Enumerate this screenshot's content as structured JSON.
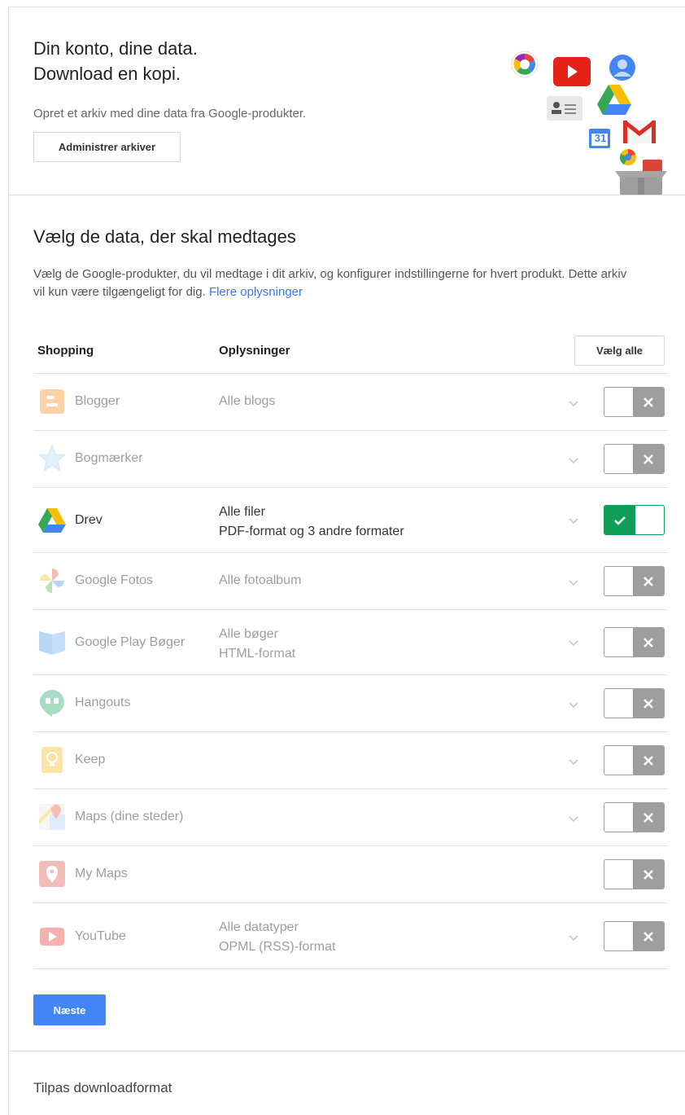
{
  "header": {
    "title_line1": "Din konto, dine data.",
    "title_line2": "Download en kopi.",
    "subtitle": "Opret et arkiv med dine data fra Google-produkter.",
    "manage_button": "Administrer arkiver",
    "calendar_badge": "31"
  },
  "section": {
    "title": "Vælg de data, der skal medtages",
    "description": "Vælg de Google-produkter, du vil medtage i dit arkiv, og konfigurer indstillingerne for hvert produkt. Dette arkiv vil kun være tilgængeligt for dig.",
    "more_link": "Flere oplysninger"
  },
  "table": {
    "col_product": "Shopping",
    "col_info": "Oplysninger",
    "select_all": "Vælg alle",
    "rows": [
      {
        "name": "Blogger",
        "info1": "Alle blogs",
        "info2": "",
        "enabled": false,
        "icon": "blogger-icon"
      },
      {
        "name": "Bogmærker",
        "info1": "",
        "info2": "",
        "enabled": false,
        "icon": "bookmarks-icon"
      },
      {
        "name": "Drev",
        "info1": "Alle filer",
        "info2": "PDF-format og 3 andre formater",
        "enabled": true,
        "icon": "drive-icon"
      },
      {
        "name": "Google Fotos",
        "info1": "Alle fotoalbum",
        "info2": "",
        "enabled": false,
        "icon": "photos-icon"
      },
      {
        "name": "Google Play Bøger",
        "info1": "Alle bøger",
        "info2": "HTML-format",
        "enabled": false,
        "icon": "play-books-icon"
      },
      {
        "name": "Hangouts",
        "info1": "",
        "info2": "",
        "enabled": false,
        "icon": "hangouts-icon"
      },
      {
        "name": "Keep",
        "info1": "",
        "info2": "",
        "enabled": false,
        "icon": "keep-icon"
      },
      {
        "name": "Maps (dine steder)",
        "info1": "",
        "info2": "",
        "enabled": false,
        "icon": "maps-icon"
      },
      {
        "name": "My Maps",
        "info1": "",
        "info2": "",
        "enabled": false,
        "icon": "my-maps-icon"
      },
      {
        "name": "YouTube",
        "info1": "Alle datatyper",
        "info2": "OPML (RSS)-format",
        "enabled": false,
        "icon": "youtube-icon"
      }
    ]
  },
  "next_button": "Næste",
  "footer": {
    "title": "Tilpas downloadformat"
  },
  "colors": {
    "accent": "#4285f4",
    "toggle_on": "#0f9d58",
    "toggle_off": "#9e9e9e"
  }
}
